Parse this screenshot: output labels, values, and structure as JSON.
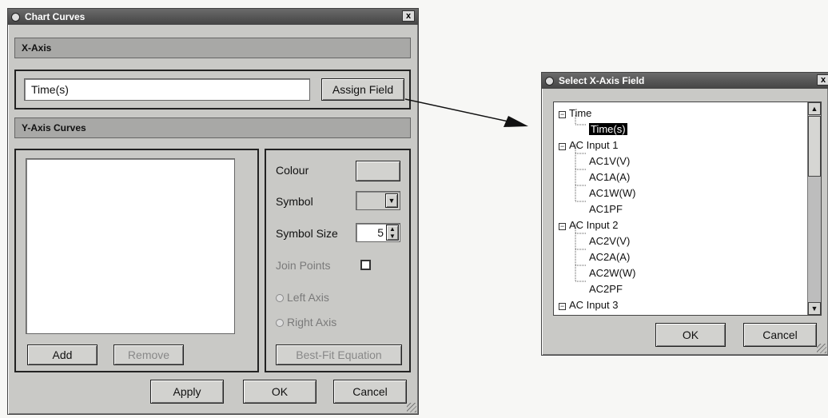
{
  "chart_curves": {
    "title": "Chart Curves",
    "close_label": "x",
    "x_axis_header": "X-Axis",
    "x_axis_field_value": "Time(s)",
    "assign_field_label": "Assign Field",
    "y_axis_header": "Y-Axis Curves",
    "add_label": "Add",
    "remove_label": "Remove",
    "colour_label": "Colour",
    "symbol_label": "Symbol",
    "symbol_size_label": "Symbol Size",
    "symbol_size_value": "5",
    "join_points_label": "Join Points",
    "left_axis_label": "Left Axis",
    "right_axis_label": "Right Axis",
    "best_fit_label": "Best-Fit Equation",
    "apply_label": "Apply",
    "ok_label": "OK",
    "cancel_label": "Cancel"
  },
  "select_x_axis": {
    "title": "Select X-Axis Field",
    "close_label": "x",
    "tree": [
      {
        "label": "Time",
        "type": "group",
        "expander": "−"
      },
      {
        "label": "Time(s)",
        "type": "leaf",
        "selected": true
      },
      {
        "label": "AC Input 1",
        "type": "group",
        "expander": "−"
      },
      {
        "label": "AC1V(V)",
        "type": "leaf"
      },
      {
        "label": "AC1A(A)",
        "type": "leaf"
      },
      {
        "label": "AC1W(W)",
        "type": "leaf"
      },
      {
        "label": "AC1PF",
        "type": "leaf"
      },
      {
        "label": "AC Input 2",
        "type": "group",
        "expander": "−"
      },
      {
        "label": "AC2V(V)",
        "type": "leaf"
      },
      {
        "label": "AC2A(A)",
        "type": "leaf"
      },
      {
        "label": "AC2W(W)",
        "type": "leaf"
      },
      {
        "label": "AC2PF",
        "type": "leaf"
      },
      {
        "label": "AC Input 3",
        "type": "group",
        "expander": "−"
      }
    ],
    "ok_label": "OK",
    "cancel_label": "Cancel"
  }
}
